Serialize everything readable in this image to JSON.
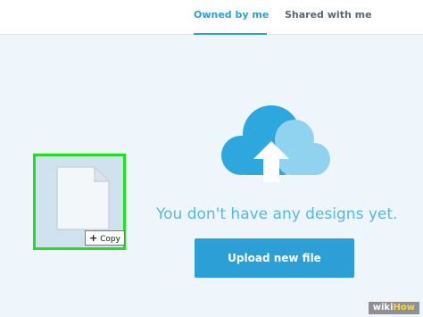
{
  "tabs": {
    "owned": "Owned by me",
    "shared": "Shared with me"
  },
  "empty_state": {
    "message": "You don't have any designs yet.",
    "upload_label": "Upload new file",
    "icon": "cloud-upload-icon"
  },
  "drag": {
    "file_icon": "file-icon",
    "copy_label": "Copy",
    "copy_prefix": "+"
  },
  "watermark": {
    "part1": "wiki",
    "part2": "How"
  },
  "colors": {
    "accent": "#2f9fd8",
    "highlight": "#1fe01c",
    "cloud_dark": "#2ea7df",
    "cloud_light": "#8fd3f1"
  }
}
